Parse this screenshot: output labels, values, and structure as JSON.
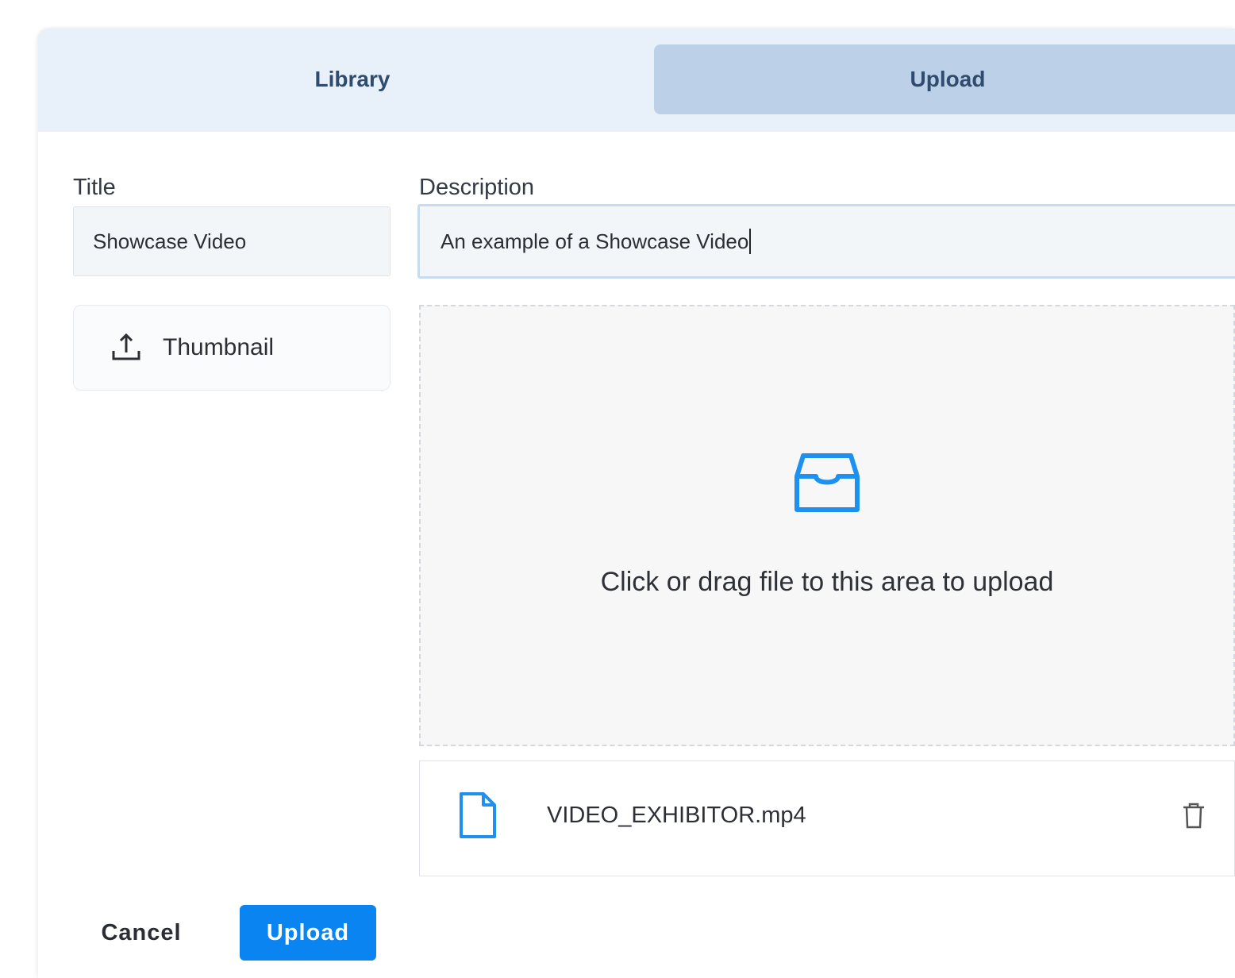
{
  "tabs": {
    "library_label": "Library",
    "upload_label": "Upload",
    "active": "Upload"
  },
  "form": {
    "title_label": "Title",
    "title_value": "Showcase Video",
    "description_label": "Description",
    "description_value": "An example of a Showcase Video",
    "thumbnail_label": "Thumbnail",
    "thumbnail_icon": "upload-icon"
  },
  "dropzone": {
    "icon": "inbox-icon",
    "hint": "Click or drag file to this area to upload"
  },
  "file_list": [
    {
      "name": "VIDEO_EXHIBITOR.mp4",
      "icon": "file-icon",
      "action_icon": "trash-icon"
    }
  ],
  "footer": {
    "cancel_label": "Cancel",
    "upload_label": "Upload"
  },
  "colors": {
    "primary": "#0a84f0",
    "tab_bar": "#e8f0f9",
    "tab_active": "#bcd0e8",
    "icon_blue": "#1e90f0"
  }
}
